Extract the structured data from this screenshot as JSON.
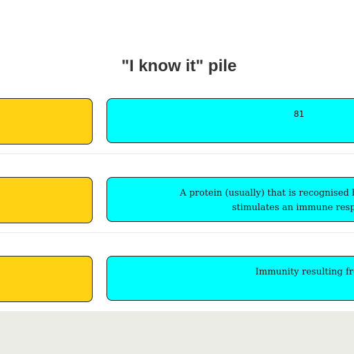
{
  "pile": {
    "title": "\"I know it\" pile"
  },
  "cards": [
    {
      "term": "",
      "definition_line1": "81",
      "definition_line2": ""
    },
    {
      "term": "",
      "definition_line1": "A protein (usually) that is recognised by the body a",
      "definition_line2": "stimulates an immune respo"
    },
    {
      "term": "",
      "definition_line1": "Immunity resulting from exposure t",
      "definition_line2": ""
    }
  ],
  "colors": {
    "term_card": "#ffd214",
    "definition_card": "#00ffff",
    "footer_band": "#ecece6"
  }
}
